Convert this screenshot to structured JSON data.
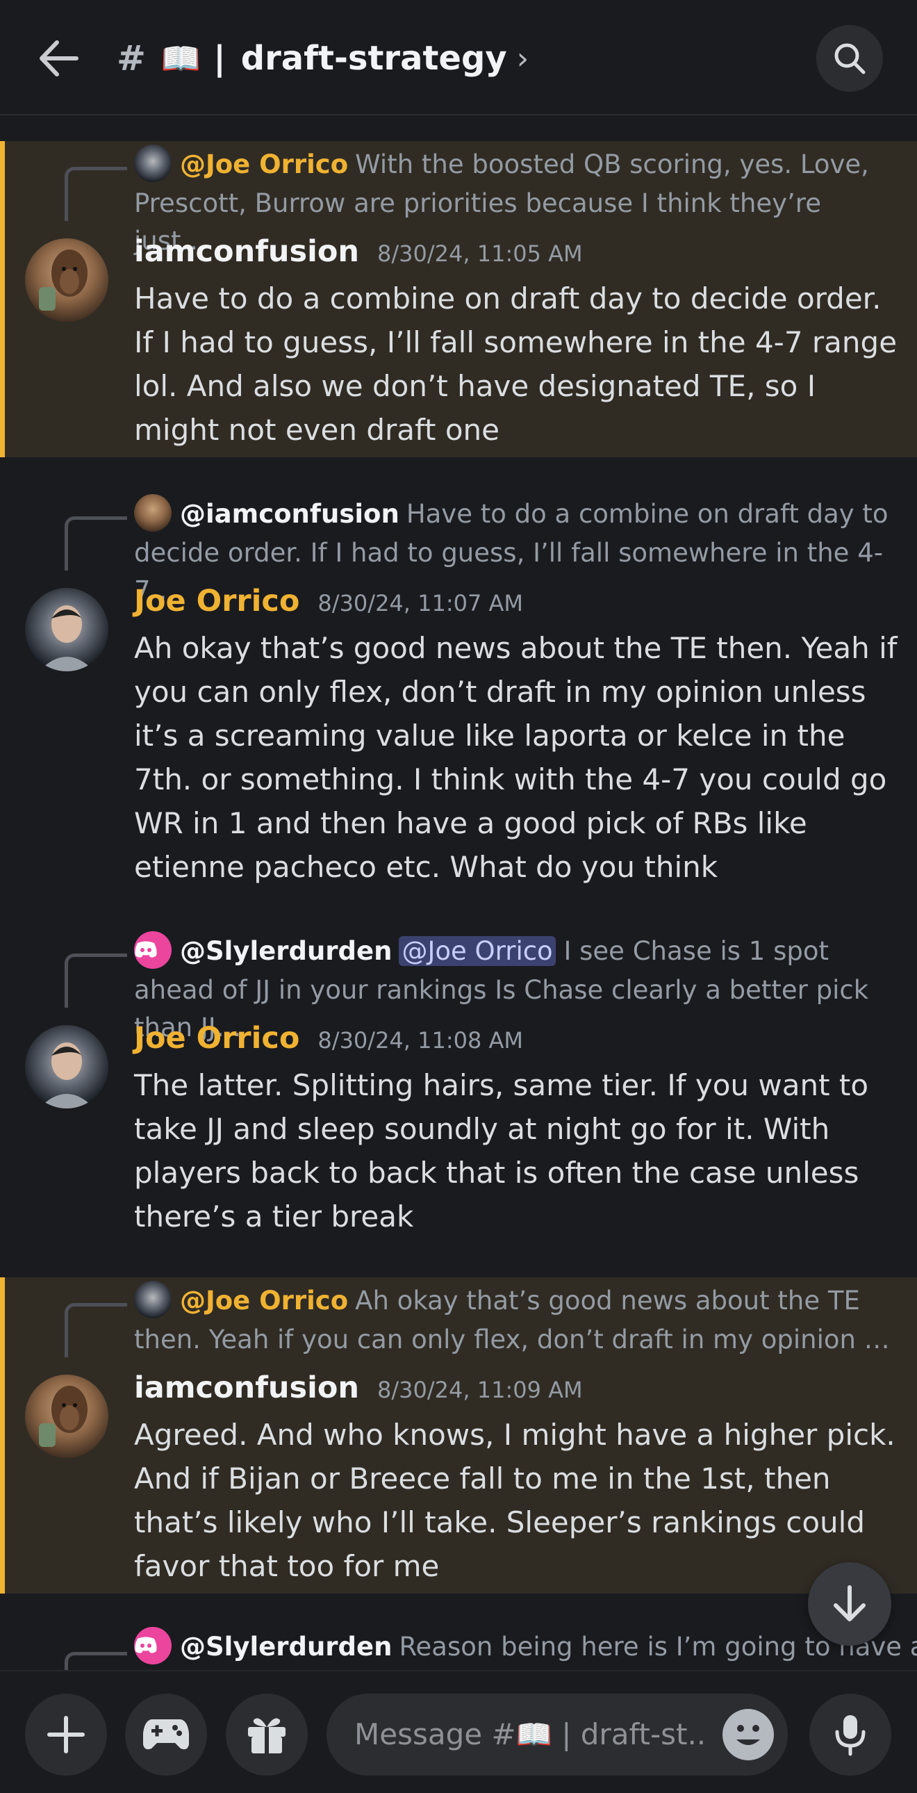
{
  "header": {
    "back_icon": "arrow-left-icon",
    "hash": "#",
    "channel_emoji": "📖",
    "separator": "|",
    "channel_name": "draft-strategy",
    "chevron": "›",
    "search_icon": "search-icon"
  },
  "messages": [
    {
      "reply_name": "@Joe Orrico",
      "reply_text": "With the boosted QB scoring, yes. Love, Prescott, Burrow are priorities because I think they’re just…",
      "author": "iamconfusion",
      "timestamp": "8/30/24, 11:05 AM",
      "body": "Have to do a combine on draft day to decide order. If I had to guess, I’ll fall somewhere in the 4-7 range lol. And also we don’t have designated TE, so I might not even draft one"
    },
    {
      "reply_name": "@iamconfusion",
      "reply_text": "Have to do a combine on draft day to decide order. If I had to guess, I’ll fall somewhere in the 4-7 …",
      "author": "Joe Orrico",
      "timestamp": "8/30/24, 11:07 AM",
      "body": "Ah okay that’s good news about the TE then. Yeah if you can only flex, don’t draft in my opinion unless it’s a screaming value like laporta or kelce in the 7th. or something. I think with the 4-7 you could go WR in 1 and then have a good pick of RBs like etienne pacheco etc. What do you think"
    },
    {
      "reply_name": "@Slylerdurden",
      "reply_mention": "@Joe Orrico",
      "reply_text": "I see Chase is 1 spot ahead of JJ in your rankings  Is Chase clearly a better pick than JJ…",
      "author": "Joe Orrico",
      "timestamp": "8/30/24, 11:08 AM",
      "body": "The latter. Splitting hairs, same tier. If you want to take JJ and sleep soundly at night go for it. With players back to back that is often the case unless there’s a tier break"
    },
    {
      "reply_name": "@Joe Orrico",
      "reply_text": "Ah okay that’s good news about the TE then. Yeah if you can only flex, don’t draft in my opinion …",
      "author": "iamconfusion",
      "timestamp": "8/30/24, 11:09 AM",
      "body": "Agreed. And who knows, I might have a higher pick. And if Bijan or Breece fall to me in the 1st, then that’s likely who I’ll take. Sleeper’s rankings could favor that too for me"
    },
    {
      "reply_name": "@Slylerdurden",
      "reply_text": "Reason being here is I’m going to have a"
    }
  ],
  "composer": {
    "placeholder": "Message #📖 | draft-st..",
    "add_icon": "plus-icon",
    "games_icon": "gamepad-icon",
    "gift_icon": "gift-icon",
    "emoji_icon": "emoji-icon",
    "mic_icon": "microphone-icon"
  },
  "colors": {
    "background": "#1a1b1f",
    "highlight_bg": "#302c24",
    "highlight_bar": "#f0b232",
    "gold_name": "#f0b232",
    "mention_bg": "#3c4270",
    "discord_pink": "#eb459e"
  }
}
